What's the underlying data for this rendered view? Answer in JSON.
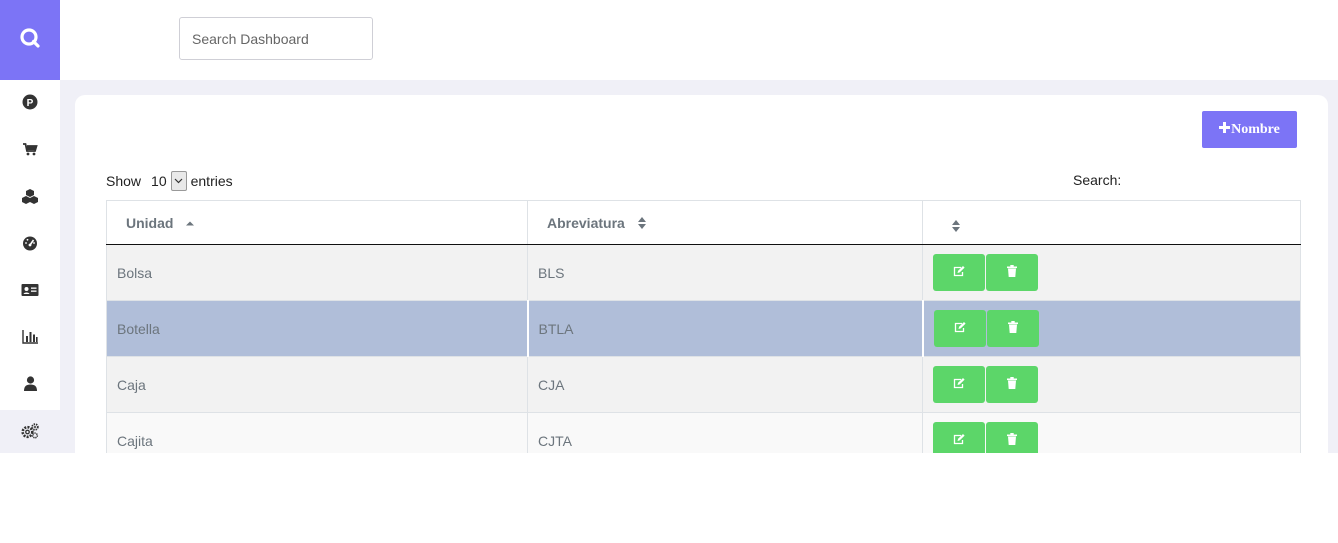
{
  "header": {
    "search_placeholder": "Search Dashboard"
  },
  "sidebar": {
    "items": [
      {
        "icon": "parking-icon"
      },
      {
        "icon": "cart-icon"
      },
      {
        "icon": "cubes-icon"
      },
      {
        "icon": "dashboard-gauge-icon"
      },
      {
        "icon": "id-card-icon"
      },
      {
        "icon": "bar-chart-icon"
      },
      {
        "icon": "user-icon"
      },
      {
        "icon": "gears-icon",
        "active": true
      }
    ]
  },
  "card": {
    "add_label": "Nombre",
    "length": {
      "prefix": "Show",
      "value": "10",
      "suffix": "entries"
    },
    "filter_label": "Search:",
    "table": {
      "columns": [
        "Unidad",
        "Abreviatura",
        ""
      ],
      "rows": [
        {
          "unidad": "Bolsa",
          "abreviatura": "BLS"
        },
        {
          "unidad": "Botella",
          "abreviatura": "BTLA",
          "selected": true
        },
        {
          "unidad": "Caja",
          "abreviatura": "CJA"
        },
        {
          "unidad": "Cajita",
          "abreviatura": "CJTA"
        }
      ]
    }
  },
  "colors": {
    "accent": "#7c74f6",
    "action_green": "#5cd669",
    "selected_row": "#b0bed9",
    "page_bg": "#f0f0f7"
  }
}
